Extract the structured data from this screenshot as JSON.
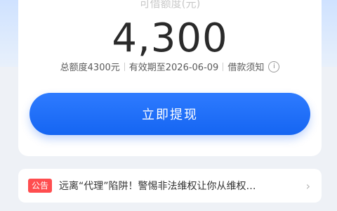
{
  "card": {
    "subtitle": "可借额度(元)",
    "amount": "4,300",
    "total_limit": "总额度4300元",
    "validity": "有效期至2026-06-09",
    "notice_link": "借款须知",
    "info_icon_glyph": "i",
    "withdraw_button": "立即提现"
  },
  "announcement": {
    "badge": "公告",
    "text": "远离“代理”陷阱！警惕非法维权让你从维权…",
    "chevron": "›"
  },
  "colors": {
    "primary": "#1565f2",
    "badge": "#ff4d4f"
  },
  "icons": [
    "info-icon",
    "chevron-right-icon"
  ]
}
